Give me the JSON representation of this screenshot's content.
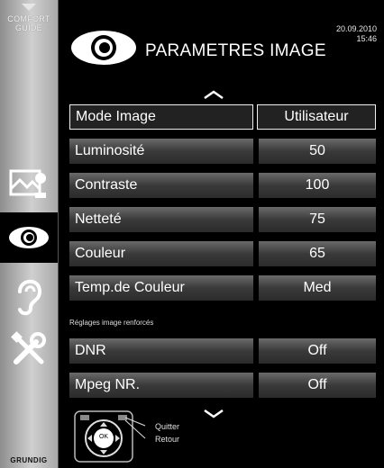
{
  "sidebar": {
    "comfort_line1": "COMFORT",
    "comfort_line2": "GUIDE",
    "brand": "GRUNDIG",
    "items": [
      {
        "icon": "picture-settings-icon"
      },
      {
        "icon": "eye-icon",
        "active": true
      },
      {
        "icon": "ear-icon"
      },
      {
        "icon": "tools-icon"
      }
    ]
  },
  "header": {
    "date": "20.09.2010",
    "time": "15:46",
    "title": "PARAMETRES IMAGE"
  },
  "menu": [
    {
      "label": "Mode Image",
      "value": "Utilisateur",
      "selected": true
    },
    {
      "label": "Luminosité",
      "value": "50"
    },
    {
      "label": "Contraste",
      "value": "100"
    },
    {
      "label": "Netteté",
      "value": "75"
    },
    {
      "label": "Couleur",
      "value": "65"
    },
    {
      "label": "Temp.de Couleur",
      "value": "Med"
    }
  ],
  "section": {
    "label": "Réglages image renforcés"
  },
  "advanced_menu": [
    {
      "label": "DNR",
      "value": "Off"
    },
    {
      "label": "Mpeg NR.",
      "value": "Off"
    }
  ],
  "footer": {
    "remote_center": "OK",
    "quit_label": "Quitter",
    "back_label": "Retour"
  },
  "colors": {
    "background": "#000000",
    "text": "#ffffff",
    "sidebar": "#bcbcbc"
  }
}
